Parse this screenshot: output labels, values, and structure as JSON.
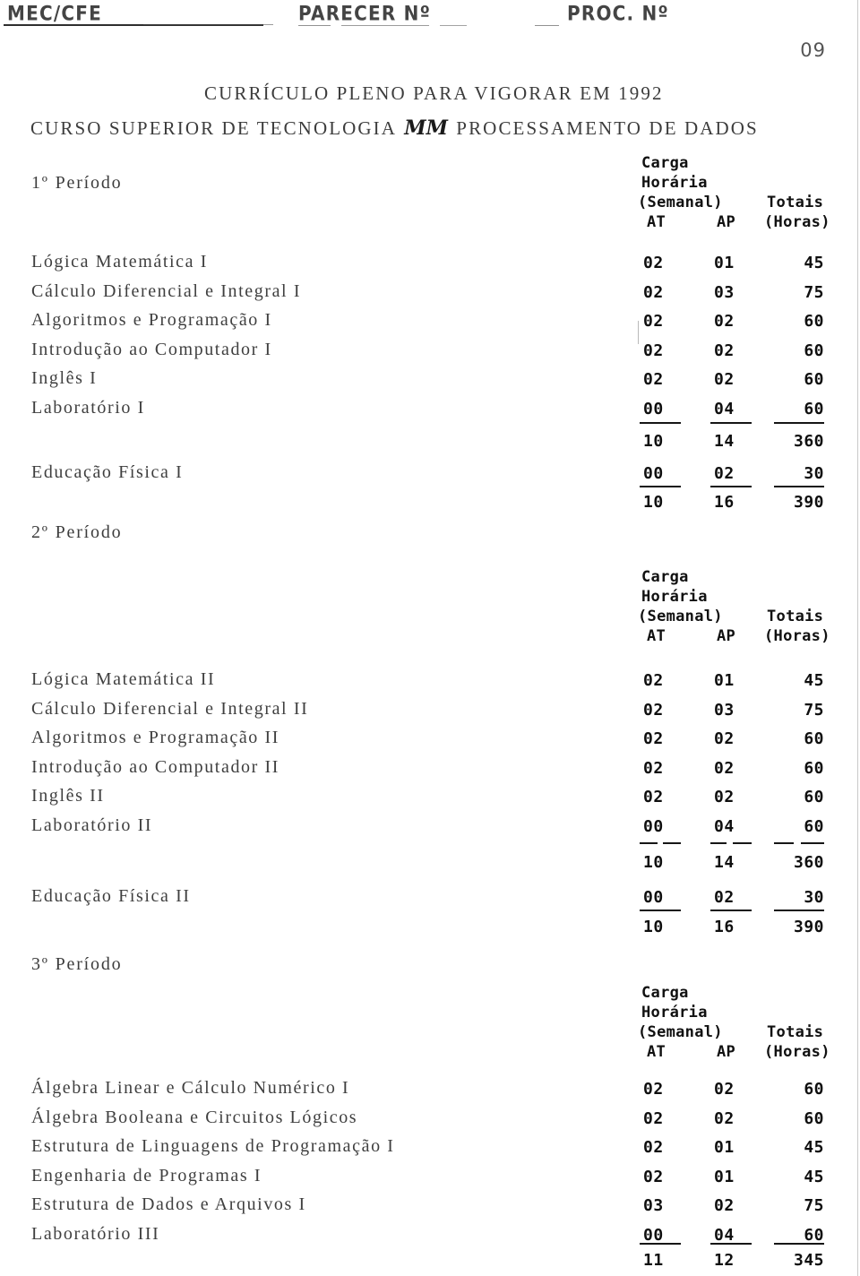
{
  "header": {
    "left": "MEC/CFE",
    "middle": "PARECER Nº",
    "right": "PROC. Nº",
    "page_number": "09"
  },
  "titles": {
    "main": "CURRÍCULO PLENO PARA VIGORAR EM 1992",
    "sub_before": "CURSO SUPERIOR DE TECNOLOGIA ",
    "sub_mark": "MM",
    "sub_after": " PROCESSAMENTO DE DADOS"
  },
  "column_header": {
    "carga": "Carga",
    "horaria": "Horária",
    "semanal": "(Semanal)",
    "totais": "Totais",
    "at": "AT",
    "ap": "AP",
    "horas": "(Horas)"
  },
  "periods": [
    {
      "label": "1º Período",
      "courses": [
        {
          "name": "Lógica Matemática I",
          "at": "02",
          "ap": "01",
          "total": "45"
        },
        {
          "name": "Cálculo Diferencial e Integral I",
          "at": "02",
          "ap": "03",
          "total": "75"
        },
        {
          "name": "Algoritmos e Programação I",
          "at": "02",
          "ap": "02",
          "total": "60"
        },
        {
          "name": "Introdução ao Computador I",
          "at": "02",
          "ap": "02",
          "total": "60"
        },
        {
          "name": "Inglês I",
          "at": "02",
          "ap": "02",
          "total": "60"
        },
        {
          "name": "Laboratório I",
          "at": "00",
          "ap": "04",
          "total": "60"
        }
      ],
      "subtotal": {
        "at": "10",
        "ap": "14",
        "total": "360"
      },
      "extra": {
        "name": "Educação Física I",
        "at": "00",
        "ap": "02",
        "total": "30"
      },
      "grandtotal": {
        "at": "10",
        "ap": "16",
        "total": "390"
      }
    },
    {
      "label": "2º Período",
      "courses": [
        {
          "name": "Lógica Matemática II",
          "at": "02",
          "ap": "01",
          "total": "45"
        },
        {
          "name": "Cálculo Diferencial e Integral II",
          "at": "02",
          "ap": "03",
          "total": "75"
        },
        {
          "name": "Algoritmos e Programação II",
          "at": "02",
          "ap": "02",
          "total": "60"
        },
        {
          "name": "Introdução ao Computador II",
          "at": "02",
          "ap": "02",
          "total": "60"
        },
        {
          "name": "Inglês II",
          "at": "02",
          "ap": "02",
          "total": "60"
        },
        {
          "name": "Laboratório II",
          "at": "00",
          "ap": "04",
          "total": "60"
        }
      ],
      "subtotal": {
        "at": "10",
        "ap": "14",
        "total": "360"
      },
      "extra": {
        "name": "Educação Física II",
        "at": "00",
        "ap": "02",
        "total": "30"
      },
      "grandtotal": {
        "at": "10",
        "ap": "16",
        "total": "390"
      }
    },
    {
      "label": "3º Período",
      "courses": [
        {
          "name": "Álgebra Linear e Cálculo Numérico I",
          "at": "02",
          "ap": "02",
          "total": "60"
        },
        {
          "name": "Álgebra Booleana e Circuitos Lógicos",
          "at": "02",
          "ap": "02",
          "total": "60"
        },
        {
          "name": "Estrutura de Linguagens de Programação I",
          "at": "02",
          "ap": "01",
          "total": "45"
        },
        {
          "name": "Engenharia de Programas I",
          "at": "02",
          "ap": "01",
          "total": "45"
        },
        {
          "name": "Estrutura de Dados e Arquivos I",
          "at": "03",
          "ap": "02",
          "total": "75"
        },
        {
          "name": "Laboratório III",
          "at": "00",
          "ap": "04",
          "total": "60"
        }
      ],
      "subtotal": {
        "at": "11",
        "ap": "12",
        "total": "345"
      }
    }
  ]
}
